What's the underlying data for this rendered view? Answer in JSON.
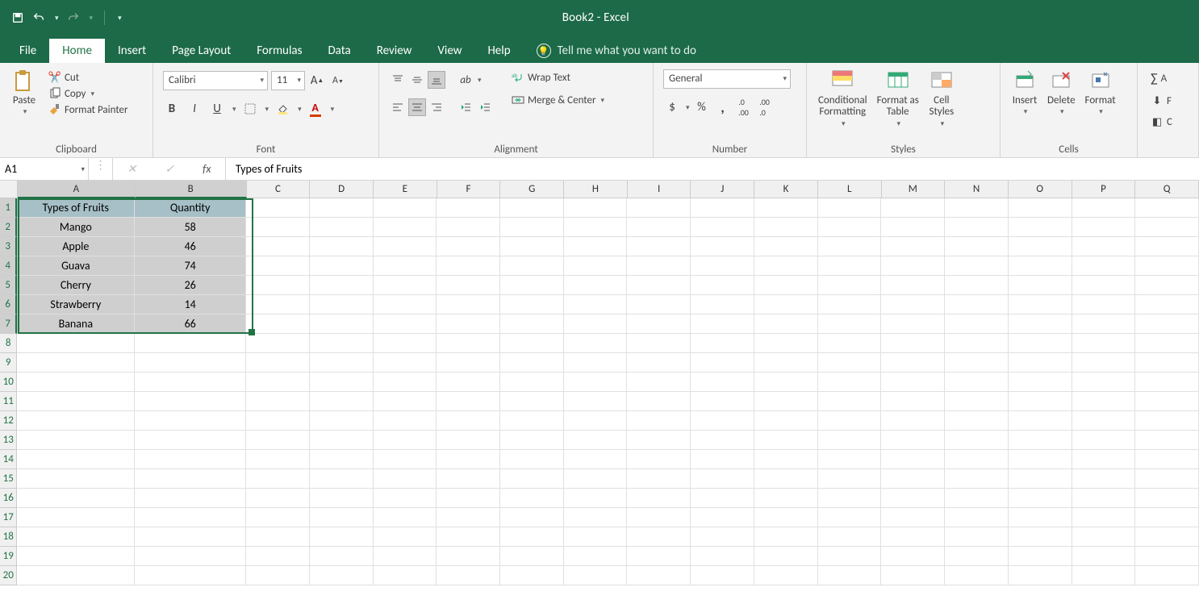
{
  "title": "Book2  -  Excel",
  "qat": {
    "save": "save-icon",
    "undo": "undo-icon",
    "redo": "redo-icon"
  },
  "tabs": [
    "File",
    "Home",
    "Insert",
    "Page Layout",
    "Formulas",
    "Data",
    "Review",
    "View",
    "Help"
  ],
  "active_tab": "Home",
  "tell_me": "Tell me what you want to do",
  "groups": {
    "clipboard": {
      "label": "Clipboard",
      "paste": "Paste",
      "cut": "Cut",
      "copy": "Copy",
      "format_painter": "Format Painter"
    },
    "font": {
      "label": "Font",
      "name": "Calibri",
      "size": "11"
    },
    "alignment": {
      "label": "Alignment",
      "wrap": "Wrap Text",
      "merge": "Merge & Center"
    },
    "number": {
      "label": "Number",
      "format": "General"
    },
    "styles": {
      "label": "Styles",
      "cond": "Conditional Formatting",
      "table": "Format as Table",
      "cell": "Cell Styles"
    },
    "cells": {
      "label": "Cells",
      "insert": "Insert",
      "delete": "Delete",
      "format": "Format"
    }
  },
  "namebox": "A1",
  "formula": "Types of Fruits",
  "columns": [
    "A",
    "B",
    "C",
    "D",
    "E",
    "F",
    "G",
    "H",
    "I",
    "J",
    "K",
    "L",
    "M",
    "N",
    "O",
    "P",
    "Q"
  ],
  "col_widths": {
    "A": 150,
    "B": 142,
    "default": 81
  },
  "row_labels": [
    "1",
    "2",
    "3",
    "4",
    "5",
    "6",
    "7",
    "8",
    "9",
    "10",
    "11",
    "12",
    "13",
    "14",
    "15",
    "16",
    "17",
    "18",
    "19",
    "20"
  ],
  "chart_data": {
    "type": "table",
    "headers": [
      "Types of Fruits",
      "Quantity"
    ],
    "rows": [
      [
        "Mango",
        58
      ],
      [
        "Apple",
        46
      ],
      [
        "Guava",
        74
      ],
      [
        "Cherry",
        26
      ],
      [
        "Strawberry",
        14
      ],
      [
        "Banana",
        66
      ]
    ]
  },
  "selection": {
    "ref": "A1:B7",
    "rows": [
      1,
      7
    ],
    "cols": [
      "A",
      "B"
    ]
  }
}
